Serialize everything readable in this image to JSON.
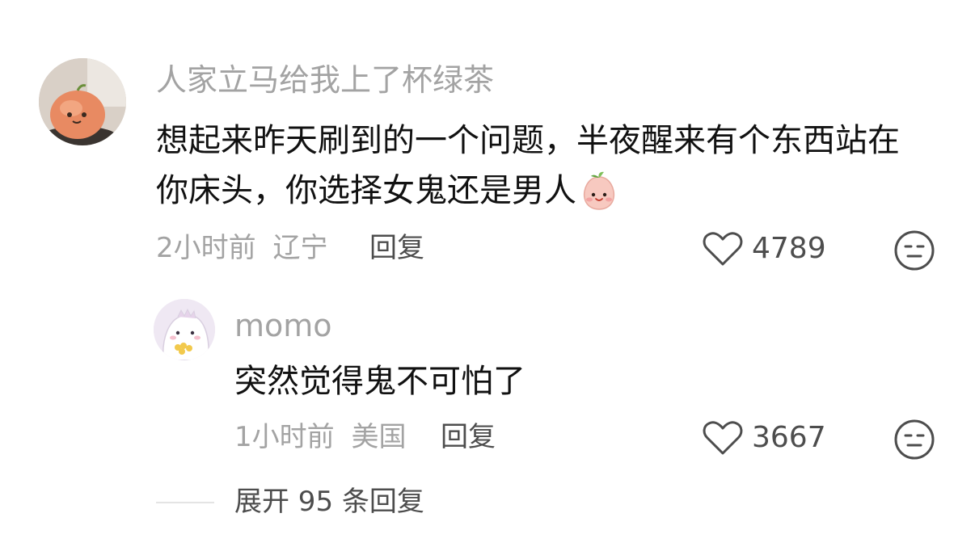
{
  "comment": {
    "username": "人家立马给我上了杯绿茶",
    "text_line1": "想起来昨天刷到的一个问题，半夜醒来有个东西站在",
    "text_line2": "你床头，你选择女鬼还是男人",
    "emoji": "peach-face-emoji",
    "time": "2小时前",
    "location": "辽宁",
    "reply_label": "回复",
    "like_count": "4789"
  },
  "reply": {
    "username": "momo",
    "text": "突然觉得鬼不可怕了",
    "time": "1小时前",
    "location": "美国",
    "reply_label": "回复",
    "like_count": "3667"
  },
  "expand": {
    "label": "展开 95 条回复"
  },
  "icons": {
    "like": "heart-outline-icon",
    "dislike": "neutral-face-icon"
  },
  "colors": {
    "username": "#a3a3a3",
    "text": "#111111",
    "meta": "#a3a3a3",
    "action": "#4d4d4d"
  }
}
